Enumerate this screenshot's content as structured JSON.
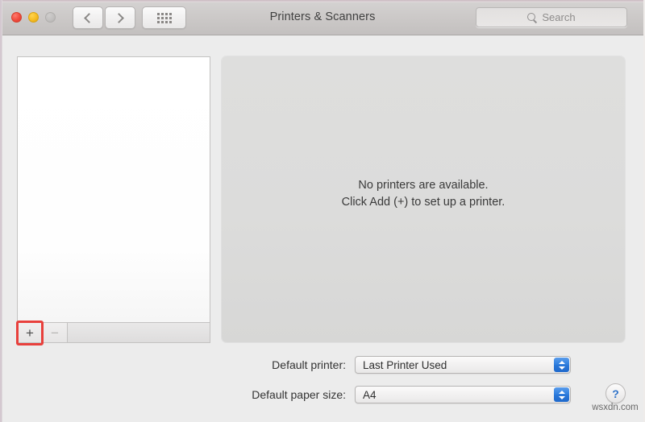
{
  "window": {
    "title": "Printers & Scanners",
    "traffic_lights": [
      {
        "name": "close",
        "color": "#f04a3d",
        "enabled": true
      },
      {
        "name": "minimize",
        "color": "#f5bc22",
        "enabled": true
      },
      {
        "name": "zoom",
        "color": "#c2c0bf",
        "enabled": false
      }
    ]
  },
  "toolbar": {
    "back_icon": "chevron-left-icon",
    "forward_icon": "chevron-right-icon",
    "show_all_icon": "grid-dots-icon"
  },
  "search": {
    "icon": "search-icon",
    "placeholder": "Search",
    "value": ""
  },
  "printer_list": {
    "items": [],
    "add_label": "+",
    "remove_label": "−",
    "add_enabled": true,
    "remove_enabled": false,
    "highlight_color": "#e8403c"
  },
  "main": {
    "empty_line1": "No printers are available.",
    "empty_line2": "Click Add (+) to set up a printer."
  },
  "settings": {
    "default_printer": {
      "label": "Default printer:",
      "value": "Last Printer Used"
    },
    "default_paper_size": {
      "label": "Default paper size:",
      "value": "A4"
    },
    "stepper_color": "#2f7fe0"
  },
  "help": {
    "icon": "question-mark-icon",
    "label": "?"
  },
  "watermark": {
    "text": "wsxdn.com"
  }
}
